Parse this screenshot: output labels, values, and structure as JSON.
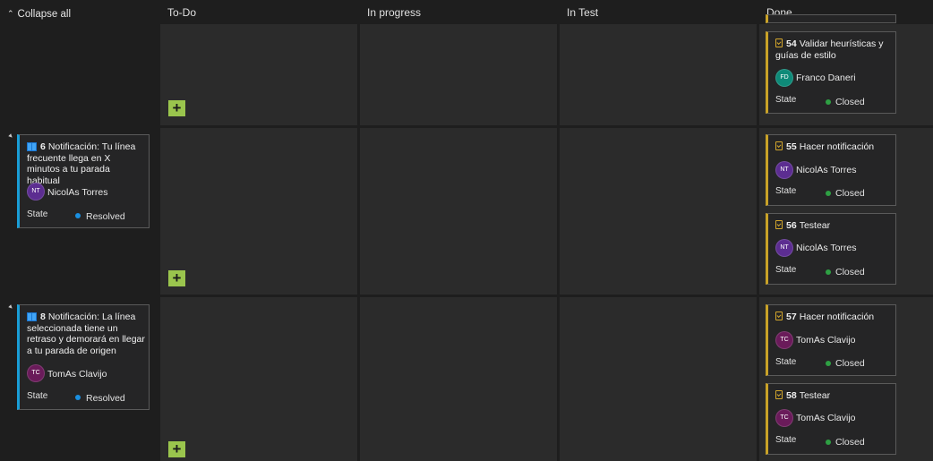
{
  "header": {
    "collapse_all": "Collapse all",
    "columns": [
      "To-Do",
      "In progress",
      "In Test",
      "Done"
    ]
  },
  "colors": {
    "add_button": "#9ac54d",
    "task_accent": "#c9a227",
    "story_accent": "#199ed7",
    "closed": "#2ea043",
    "resolved": "#1a8fe0"
  },
  "stories": [
    {
      "id": "6",
      "title": "Notificación: Tu línea frecuente llega en X minutos a tu parada habitual",
      "initials": "NT",
      "assignee": "NicolAs Torres",
      "state_label": "State",
      "state": "Resolved"
    },
    {
      "id": "8",
      "title": "Notificación: La línea seleccionada tiene un retraso y demorará en llegar a tu parada de origen",
      "initials": "TC",
      "assignee": "TomAs Clavijo",
      "state_label": "State",
      "state": "Resolved"
    }
  ],
  "done": {
    "row1": [
      {
        "id": "54",
        "title": "Validar heurísticas y guías de estilo",
        "initials": "FD",
        "assignee": "Franco Daneri",
        "state_label": "State",
        "state": "Closed"
      }
    ],
    "row2": [
      {
        "id": "55",
        "title": "Hacer notificación",
        "initials": "NT",
        "assignee": "NicolAs Torres",
        "state_label": "State",
        "state": "Closed"
      },
      {
        "id": "56",
        "title": "Testear",
        "initials": "NT",
        "assignee": "NicolAs Torres",
        "state_label": "State",
        "state": "Closed"
      }
    ],
    "row3": [
      {
        "id": "57",
        "title": "Hacer notificación",
        "initials": "TC",
        "assignee": "TomAs Clavijo",
        "state_label": "State",
        "state": "Closed"
      },
      {
        "id": "58",
        "title": "Testear",
        "initials": "TC",
        "assignee": "TomAs Clavijo",
        "state_label": "State",
        "state": "Closed"
      }
    ]
  },
  "add_button_glyph": "+"
}
